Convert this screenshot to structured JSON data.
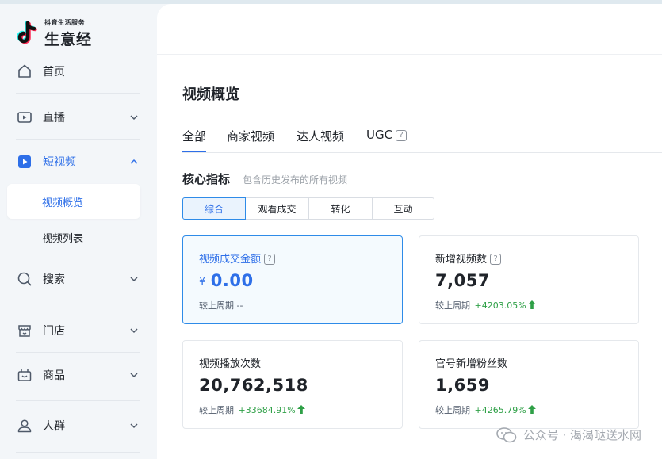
{
  "app": {
    "logo_sub": "抖音生活服务",
    "logo_main": "生意经"
  },
  "sidebar": {
    "items": [
      {
        "label": "首页",
        "icon": "home-icon",
        "expandable": false
      },
      {
        "label": "直播",
        "icon": "live-icon",
        "expandable": true,
        "expanded": false
      },
      {
        "label": "短视频",
        "icon": "video-play-icon",
        "expandable": true,
        "expanded": true,
        "active": true
      },
      {
        "label": "搜索",
        "icon": "search-icon",
        "expandable": true,
        "expanded": false
      },
      {
        "label": "门店",
        "icon": "store-icon",
        "expandable": true,
        "expanded": false
      },
      {
        "label": "商品",
        "icon": "basket-icon",
        "expandable": true,
        "expanded": false
      },
      {
        "label": "人群",
        "icon": "user-icon",
        "expandable": true,
        "expanded": false
      }
    ],
    "sub_items": [
      {
        "label": "视频概览",
        "active": true
      },
      {
        "label": "视频列表",
        "active": false
      }
    ]
  },
  "main": {
    "page_title": "视频概览",
    "tabs": [
      {
        "label": "全部",
        "active": true
      },
      {
        "label": "商家视频",
        "active": false
      },
      {
        "label": "达人视频",
        "active": false
      },
      {
        "label": "UGC",
        "active": false,
        "help": "?"
      }
    ],
    "section": {
      "title": "核心指标",
      "desc": "包含历史发布的所有视频"
    },
    "segments": [
      {
        "label": "综合",
        "active": true
      },
      {
        "label": "观看成交",
        "active": false
      },
      {
        "label": "转化",
        "active": false
      },
      {
        "label": "互动",
        "active": false
      }
    ],
    "cards": [
      {
        "title": "视频成交金额",
        "help": "?",
        "currency": "¥",
        "value": "0.00",
        "compare_label": "较上周期",
        "change": "--",
        "trend": "none",
        "active": true
      },
      {
        "title": "新增视频数",
        "help": "?",
        "value": "7,057",
        "compare_label": "较上周期",
        "change": "+4203.05%",
        "trend": "up",
        "active": false
      },
      {
        "title": "视频播放次数",
        "value": "20,762,518",
        "compare_label": "较上周期",
        "change": "+33684.91%",
        "trend": "up",
        "active": false
      },
      {
        "title": "官号新增粉丝数",
        "value": "1,659",
        "compare_label": "较上周期",
        "change": "+4265.79%",
        "trend": "up",
        "active": false
      }
    ]
  },
  "watermark": {
    "text": "公众号 · 渴渴哒送水网"
  },
  "colors": {
    "accent": "#2e6fe8",
    "up": "#2fa047",
    "sidebar_bg": "#f3f6f9"
  }
}
